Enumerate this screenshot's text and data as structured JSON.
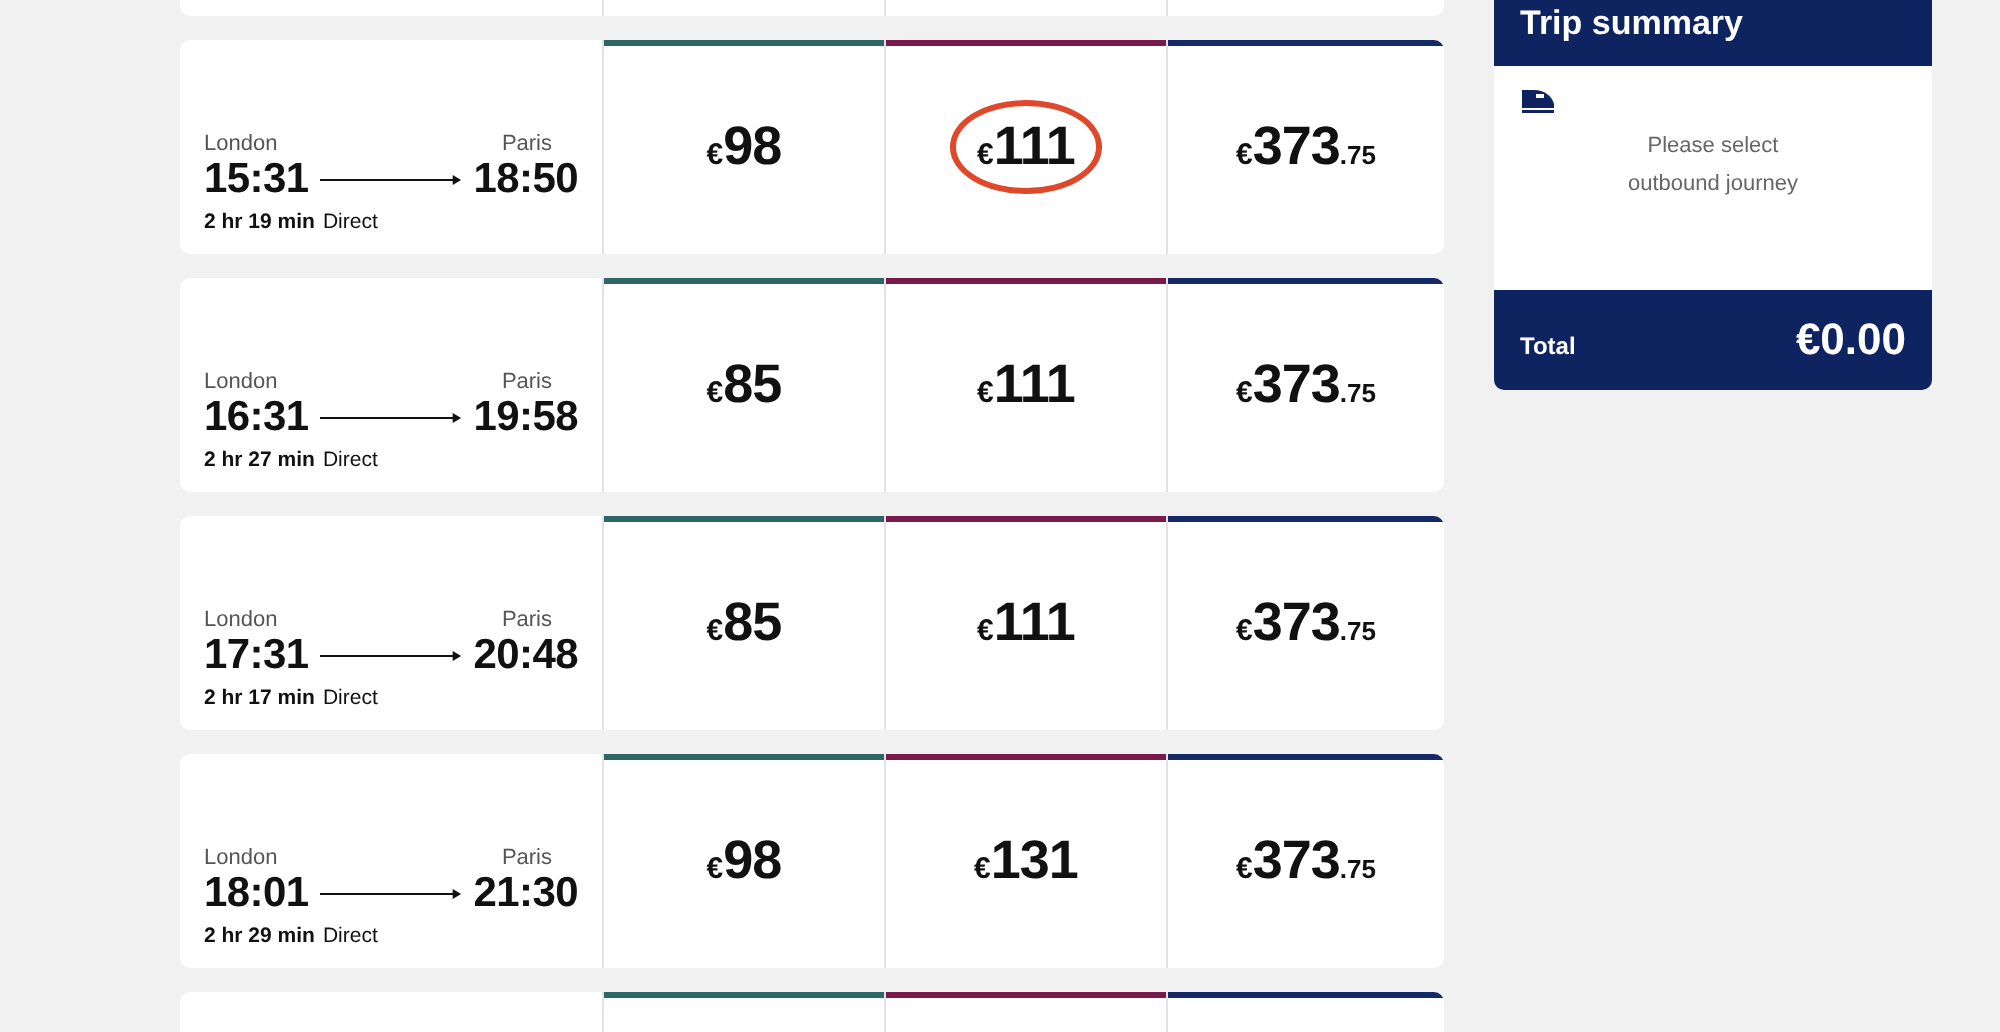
{
  "fare_classes": [
    {
      "color": "#2e6565"
    },
    {
      "color": "#7a1a4a"
    },
    {
      "color": "#142a66"
    }
  ],
  "journeys": [
    {
      "origin": "London",
      "destination": "Paris",
      "depart": "15:31",
      "arrive": "18:50",
      "duration": "2 hr 19 min",
      "stops": "Direct",
      "fares": [
        {
          "currency": "€",
          "amount": "98",
          "highlighted": false
        },
        {
          "currency": "€",
          "amount": "111",
          "highlighted": true
        },
        {
          "currency": "€",
          "amount": "373",
          "decimals": ".75",
          "highlighted": false
        }
      ]
    },
    {
      "origin": "London",
      "destination": "Paris",
      "depart": "16:31",
      "arrive": "19:58",
      "duration": "2 hr 27 min",
      "stops": "Direct",
      "fares": [
        {
          "currency": "€",
          "amount": "85",
          "highlighted": false
        },
        {
          "currency": "€",
          "amount": "111",
          "highlighted": false
        },
        {
          "currency": "€",
          "amount": "373",
          "decimals": ".75",
          "highlighted": false
        }
      ]
    },
    {
      "origin": "London",
      "destination": "Paris",
      "depart": "17:31",
      "arrive": "20:48",
      "duration": "2 hr 17 min",
      "stops": "Direct",
      "fares": [
        {
          "currency": "€",
          "amount": "85",
          "highlighted": false
        },
        {
          "currency": "€",
          "amount": "111",
          "highlighted": false
        },
        {
          "currency": "€",
          "amount": "373",
          "decimals": ".75",
          "highlighted": false
        }
      ]
    },
    {
      "origin": "London",
      "destination": "Paris",
      "depart": "18:01",
      "arrive": "21:30",
      "duration": "2 hr 29 min",
      "stops": "Direct",
      "fares": [
        {
          "currency": "€",
          "amount": "98",
          "highlighted": false
        },
        {
          "currency": "€",
          "amount": "131",
          "highlighted": false
        },
        {
          "currency": "€",
          "amount": "373",
          "decimals": ".75",
          "highlighted": false
        }
      ]
    }
  ],
  "summary": {
    "title": "Trip summary",
    "message": [
      "Please select",
      "outbound journey"
    ],
    "total_label": "Total",
    "total": "€0.00"
  }
}
